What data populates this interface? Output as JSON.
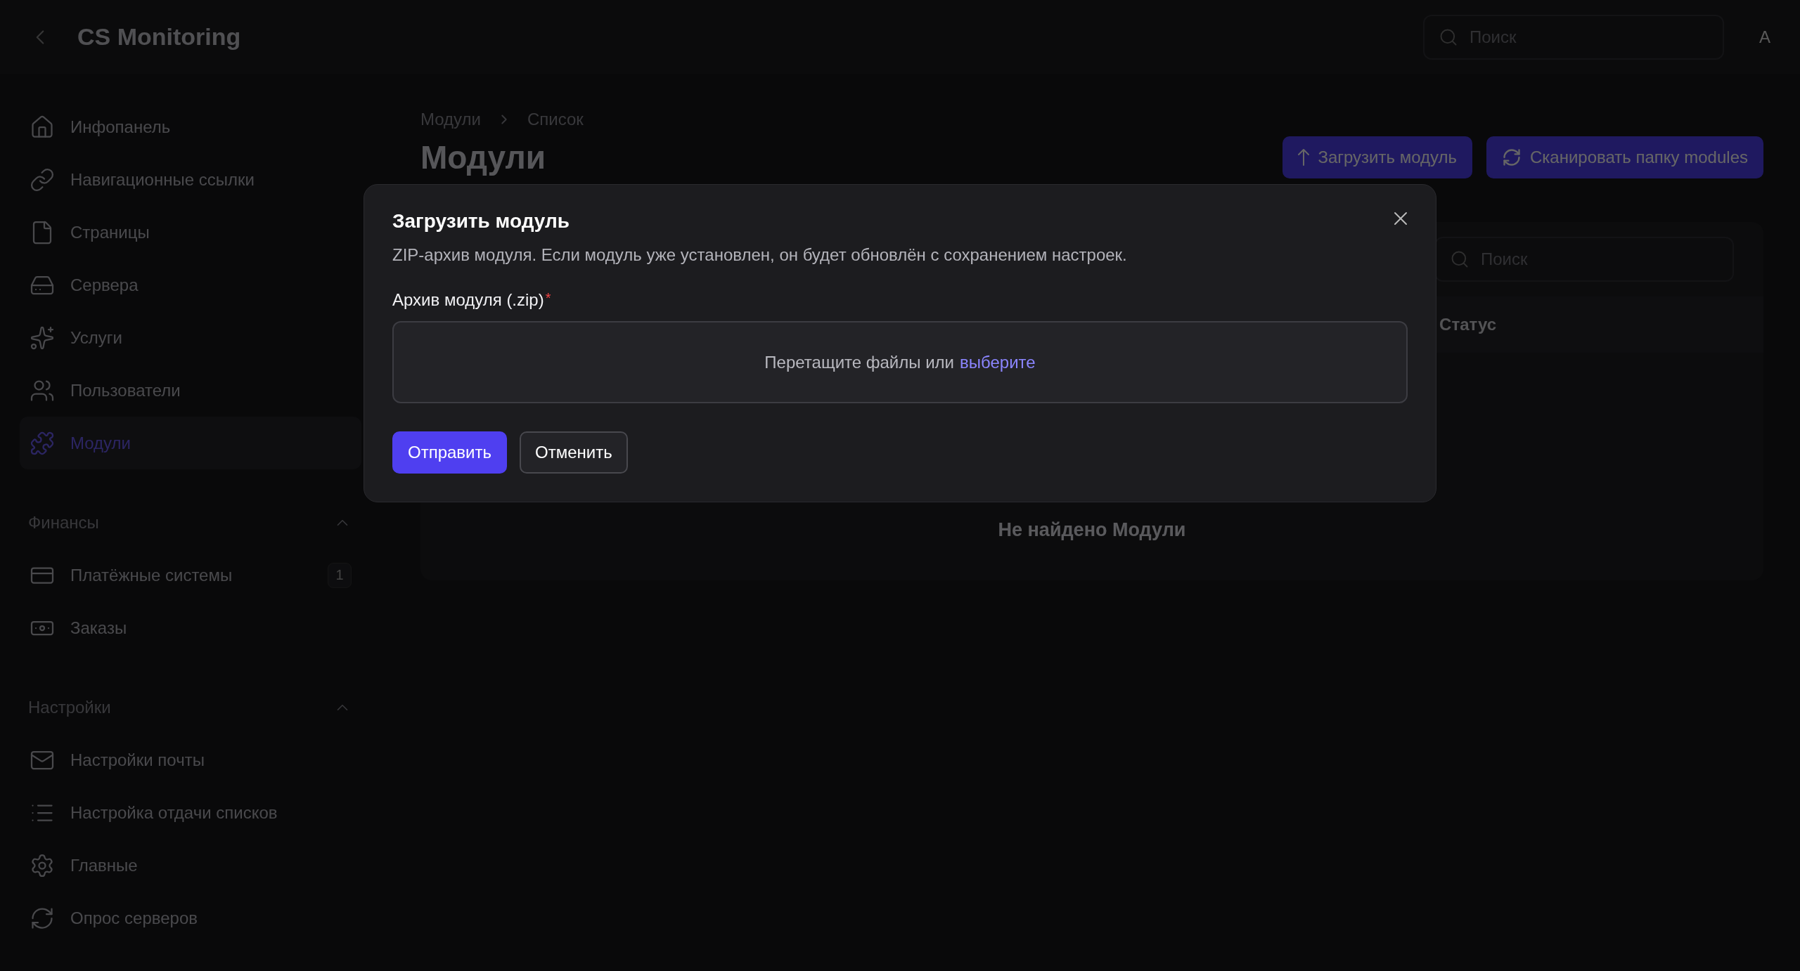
{
  "topbar": {
    "title": "CS Monitoring",
    "search": {
      "placeholder": "Поиск"
    },
    "avatar": "A"
  },
  "sidebar": {
    "items": [
      {
        "label": "Инфопанель",
        "selected": false
      },
      {
        "label": "Навигационные ссылки",
        "selected": false
      },
      {
        "label": "Страницы",
        "selected": false
      },
      {
        "label": "Сервера",
        "selected": false
      },
      {
        "label": "Услуги",
        "selected": false
      },
      {
        "label": "Пользователи",
        "selected": false
      },
      {
        "label": "Модули",
        "selected": true
      }
    ],
    "groups": [
      {
        "title": "Финансы",
        "expanded": true,
        "items": [
          {
            "label": "Платёжные системы",
            "badge": "1",
            "selected": false
          },
          {
            "label": "Заказы",
            "selected": false
          }
        ]
      },
      {
        "title": "Настройки",
        "expanded": true,
        "items": [
          {
            "label": "Настройки почты",
            "selected": false
          },
          {
            "label": "Настройка отдачи списков",
            "selected": false
          },
          {
            "label": "Главные",
            "selected": false
          },
          {
            "label": "Опрос серверов",
            "selected": false
          }
        ]
      }
    ]
  },
  "breadcrumbs": [
    "Модули",
    "Список"
  ],
  "page_title": "Модули",
  "actions": [
    {
      "label": "Загрузить модуль"
    },
    {
      "label": "Сканировать папку modules"
    }
  ],
  "table": {
    "search": {
      "placeholder": "Поиск"
    },
    "columns": [
      "Статус"
    ],
    "empty": "Не найдено Модули"
  },
  "modal": {
    "title": "Загрузить модуль",
    "description": "ZIP-архив модуля. Если модуль уже установлен, он будет обновлён с сохранением настроек.",
    "field": {
      "label": "Архив модуля (.zip)",
      "required_mark": "*",
      "drop_text": "Перетащите файлы или",
      "link": "выберите"
    },
    "buttons": [
      {
        "label": "Отправить",
        "kind": "primary"
      },
      {
        "label": "Отменить",
        "kind": "secondary"
      }
    ]
  }
}
